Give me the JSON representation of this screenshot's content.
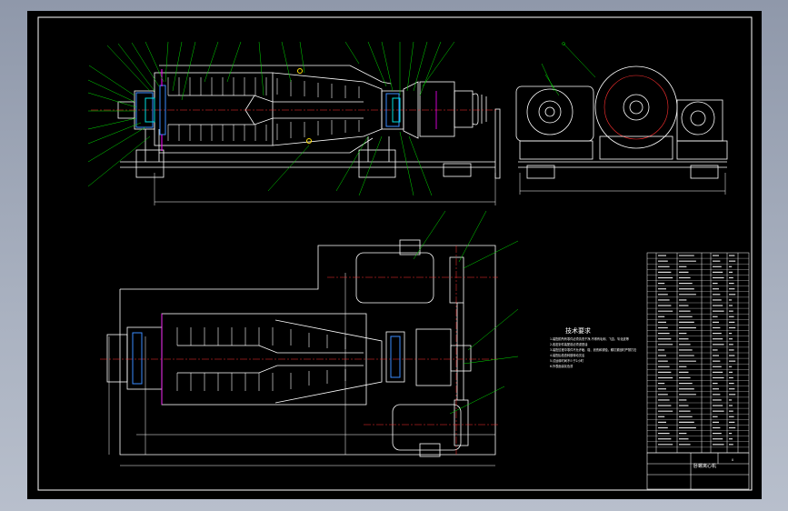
{
  "drawing": {
    "technical_requirements": {
      "title": "技术要求",
      "items": [
        "1.装配前所有零件必须清洗干净,不得有毛刺、飞边、氧化皮等",
        "2.各密封件装配前必须浸透油",
        "3.装配过程中零件不允许磕、碰、划伤和锈蚀，螺钉紧固时严禁打击",
        "4.装配后检查转鼓转动灵活",
        "5.试运转时间不少于2小时",
        "6.外表面涂灰色漆"
      ]
    },
    "title_block": {
      "name": "卧螺离心机",
      "sheet_no": "0"
    },
    "colors": {
      "outline": "#ffffff",
      "leader": "#00dd00",
      "seal": "#3a8cff",
      "center": "#ff3030",
      "accent": "#ff00ff",
      "cyan": "#00e0e0",
      "yellow": "#ffe000"
    }
  }
}
